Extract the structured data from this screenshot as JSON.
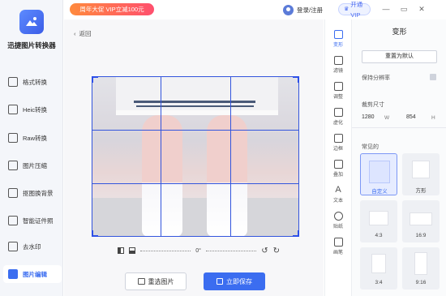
{
  "app": {
    "brand": "迅捷图片转换器",
    "promo": "周年大促 VIP立减100元",
    "login": "登录/注册",
    "vip": "开通VIP"
  },
  "window": {
    "icons": [
      "minimize-icon",
      "restore-icon",
      "close-icon"
    ],
    "labels": [
      "—",
      "▭",
      "✕"
    ]
  },
  "sidebar": {
    "items": [
      {
        "label": "格式转换",
        "icon": "format-icon"
      },
      {
        "label": "Heic转换",
        "icon": "heic-icon"
      },
      {
        "label": "Raw转换",
        "icon": "raw-icon"
      },
      {
        "label": "图片压缩",
        "icon": "compress-icon"
      },
      {
        "label": "抠图换背景",
        "icon": "cutout-icon"
      },
      {
        "label": "智能证件照",
        "icon": "id-photo-icon"
      },
      {
        "label": "去水印",
        "icon": "watermark-icon"
      },
      {
        "label": "图片编辑",
        "icon": "edit-icon",
        "active": true
      }
    ]
  },
  "main": {
    "back": "返回",
    "rotation": "0°",
    "reselect": "重选图片",
    "save": "立即保存"
  },
  "tools": [
    {
      "label": "变形",
      "active": true
    },
    {
      "label": "滤镜"
    },
    {
      "label": "调整"
    },
    {
      "label": "虚化"
    },
    {
      "label": "边框"
    },
    {
      "label": "叠加"
    },
    {
      "label": "文本"
    },
    {
      "label": "贴纸"
    },
    {
      "label": "画笔"
    }
  ],
  "panel": {
    "title": "变形",
    "reset": "重置为默认",
    "keep_ratio": "保持分辨率",
    "crop_size": "裁剪尺寸",
    "width": "1280",
    "width_unit": "W",
    "height": "854",
    "height_unit": "H",
    "common": "常见的",
    "presets": [
      "自定义",
      "方形",
      "4:3",
      "16:9",
      "3:4",
      "9:16"
    ]
  },
  "colors": {
    "accent": "#3b6df0",
    "promo_start": "#ff8a3d",
    "promo_end": "#ff4f6e",
    "sidebar_bg": "#f4f6fa"
  }
}
